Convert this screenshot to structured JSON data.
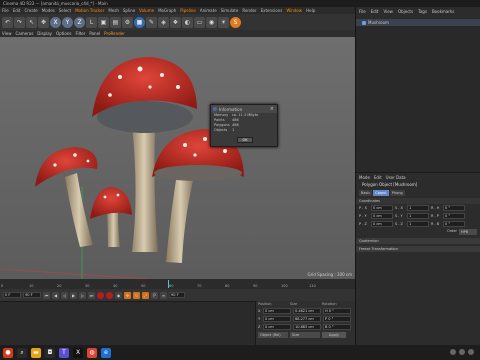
{
  "window": {
    "title": "Cinema 4D R23 — [amanita_muscaria_c4d_*] - Main"
  },
  "menubar": {
    "items": [
      "File",
      "Edit",
      "Create",
      "Modes",
      "Select",
      "Tools",
      "Mesh",
      "Spline",
      "Volume",
      "MoGraph",
      "Character",
      "Animate",
      "Simulate",
      "Tracker",
      "Render",
      "Extensions",
      "Window",
      "Help"
    ],
    "highlights": [
      "Motion Tracker",
      "Volume",
      "Pipeline",
      "Window"
    ]
  },
  "toolbar": {
    "axis_labels": [
      "X",
      "Y",
      "Z"
    ],
    "coord_label": "L"
  },
  "viewport_menu": {
    "items": [
      "View",
      "Cameras",
      "Display",
      "Options",
      "Filter",
      "Panel",
      "ProRender"
    ],
    "active": "ProRender"
  },
  "viewport": {
    "grid_spacing": "Grid Spacing : 100 cm"
  },
  "dialog": {
    "title": "Information",
    "rows": [
      {
        "key": "Memory",
        "value": "ca. 11.3 MByte"
      },
      {
        "key": "Points",
        "value": "486"
      },
      {
        "key": "Polygons",
        "value": "486"
      },
      {
        "key": "Objects",
        "value": "1"
      }
    ],
    "ok_label": "OK"
  },
  "timeline": {
    "ticks": [
      "0",
      "10",
      "20",
      "30",
      "40",
      "50",
      "60",
      "70",
      "80",
      "90",
      "100",
      "110",
      "120"
    ],
    "current_frame": "0 F"
  },
  "transport": {
    "start": "0 F",
    "end": "90 F",
    "fps": "90 F"
  },
  "coords": {
    "headers": [
      "Position",
      "Size",
      "Rotation"
    ],
    "rows": [
      {
        "axis": "X",
        "pos": "0 cm",
        "size": "0.4621 cm",
        "rot": "H 0 °"
      },
      {
        "axis": "Y",
        "pos": "0 cm",
        "size": "68.277 cm",
        "rot": "P 0 °"
      },
      {
        "axis": "Z",
        "pos": "0 cm",
        "size": "10.683 cm",
        "rot": "B 0 °"
      }
    ],
    "mode": "Object (Rel)",
    "size_mode": "Size",
    "apply_label": "Apply"
  },
  "objects_panel": {
    "menu": [
      "File",
      "Edit",
      "View",
      "Objects",
      "Tags",
      "Bookmarks"
    ],
    "object_name": "Mushroom"
  },
  "attributes_panel": {
    "menu": [
      "Mode",
      "Edit",
      "User Data"
    ],
    "title": "Polygon Object [Mushroom]",
    "tabs": [
      "Basic",
      "Coord.",
      "Phong"
    ],
    "active_tab": "Coord.",
    "coord_section": "Coordinates",
    "rows": [
      {
        "a": "P . X",
        "av": "0 cm",
        "b": "S . X",
        "bv": "1",
        "c": "R . H",
        "cv": "0 °"
      },
      {
        "a": "P . Y",
        "av": "0 cm",
        "b": "S . Y",
        "bv": "1",
        "c": "R . P",
        "cv": "0 °"
      },
      {
        "a": "P . Z",
        "av": "0 cm",
        "b": "S . Z",
        "bv": "1",
        "c": "R . B",
        "cv": "0 °"
      }
    ],
    "order_label": "Order",
    "order_value": "HPB",
    "quaternion": "Quaternion",
    "freeze": "Freeze Transformation"
  },
  "colors": {
    "accent": "#ff8c00",
    "cap_red": "#c8281e",
    "selection": "#5e86c9"
  }
}
